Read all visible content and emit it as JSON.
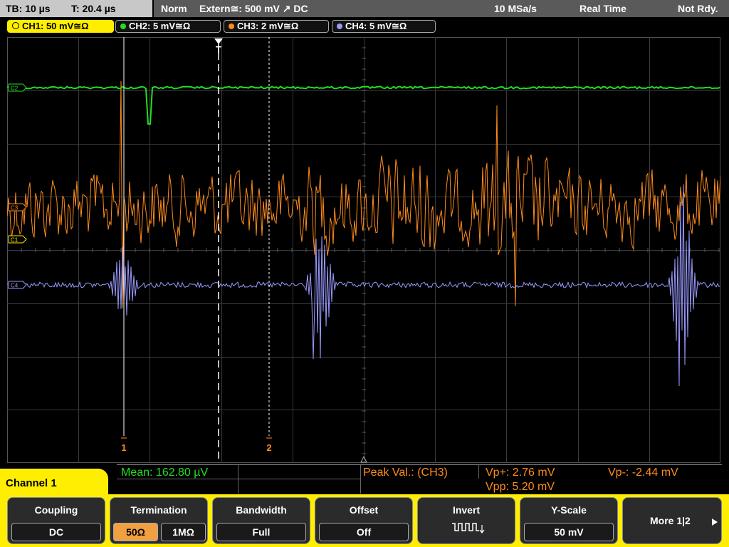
{
  "status_bar": {
    "timebase": "TB: 10 µs",
    "trigger_time": "T: 20.4 µs",
    "trigger_mode": "Norm",
    "trigger_source": "Extern≅: 500 mV ↗ DC",
    "sample_rate": "10 MSa/s",
    "acq_mode": "Real Time",
    "status": "Not Rdy."
  },
  "channels": [
    {
      "label": "CH1: 50 mV≅Ω",
      "color": "#ffee00",
      "active": true
    },
    {
      "label": "CH2: 5 mV≅Ω",
      "color": "#22dd22",
      "active": false
    },
    {
      "label": "CH3: 2 mV≅Ω",
      "color": "#ff8c1a",
      "active": false
    },
    {
      "label": "CH4: 5 mV≅Ω",
      "color": "#9a9aff",
      "active": false
    }
  ],
  "waveform_markers": {
    "c2": "C2",
    "c3": "C3",
    "c1": "C1",
    "c4": "C4",
    "trigger": "T",
    "cursor1": "1",
    "cursor2": "2"
  },
  "measurements": {
    "mean": "Mean: 162.80 µV",
    "peak_label": "Peak Val.:  (CH3)",
    "vp_plus": "Vp+: 2.76 mV",
    "vp_minus": "Vp-: -2.44 mV",
    "vpp": "Vpp: 5.20 mV"
  },
  "menu": {
    "title": "Channel 1",
    "coupling": {
      "title": "Coupling",
      "value": "DC"
    },
    "termination": {
      "title": "Termination",
      "option1": "50Ω",
      "option2": "1MΩ",
      "selected": "50Ω"
    },
    "bandwidth": {
      "title": "Bandwidth",
      "value": "Full"
    },
    "offset": {
      "title": "Offset",
      "value": "Off"
    },
    "invert": {
      "title": "Invert"
    },
    "yscale": {
      "title": "Y-Scale",
      "value": "50 mV"
    },
    "more": "More 1|2"
  },
  "colors": {
    "ch1": "#ffee00",
    "ch2": "#22dd22",
    "ch3": "#ff8c1a",
    "ch4": "#9a9aff",
    "grid": "#3a3a3a",
    "softkey_bar": "#ffee00"
  }
}
